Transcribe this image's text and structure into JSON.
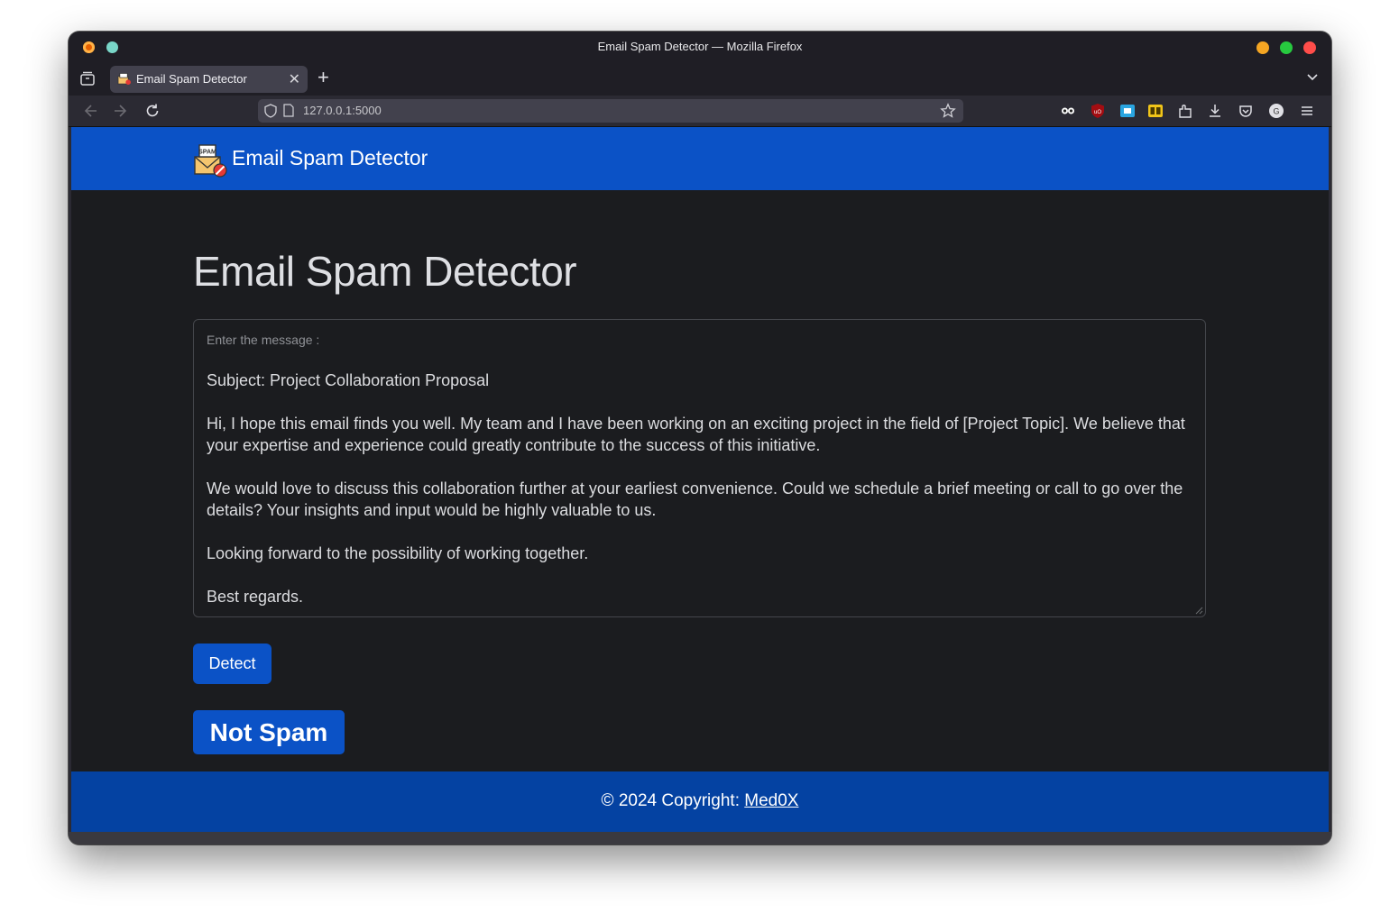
{
  "window": {
    "title": "Email Spam Detector — Mozilla Firefox"
  },
  "tab": {
    "title": "Email Spam Detector"
  },
  "urlbar": {
    "url": "127.0.0.1:5000"
  },
  "site": {
    "brand": "Email Spam Detector",
    "page_title": "Email Spam Detector",
    "message_label": "Enter the message :",
    "message_text": "Subject: Project Collaboration Proposal\n\nHi, I hope this email finds you well. My team and I have been working on an exciting project in the field of [Project Topic]. We believe that your expertise and experience could greatly contribute to the success of this initiative.\n\nWe would love to discuss this collaboration further at your earliest convenience. Could we schedule a brief meeting or call to go over the details? Your insights and input would be highly valuable to us.\n\nLooking forward to the possibility of working together.\n\nBest regards.",
    "detect_label": "Detect",
    "result_label": "Not Spam",
    "footer_prefix": "© 2024 Copyright: ",
    "footer_link": "Med0X"
  },
  "colors": {
    "primary": "#0b52c6",
    "footer": "#0442a2",
    "page_bg": "#1b1c1f"
  },
  "icons": [
    "firefox-icon",
    "tabs-list-icon",
    "close-icon",
    "plus-icon",
    "chevron-down-icon",
    "back-icon",
    "forward-icon",
    "reload-icon",
    "shield-icon",
    "page-icon",
    "star-icon",
    "extension-icon",
    "download-icon",
    "pocket-icon",
    "account-icon",
    "menu-icon",
    "spam-mail-icon"
  ]
}
